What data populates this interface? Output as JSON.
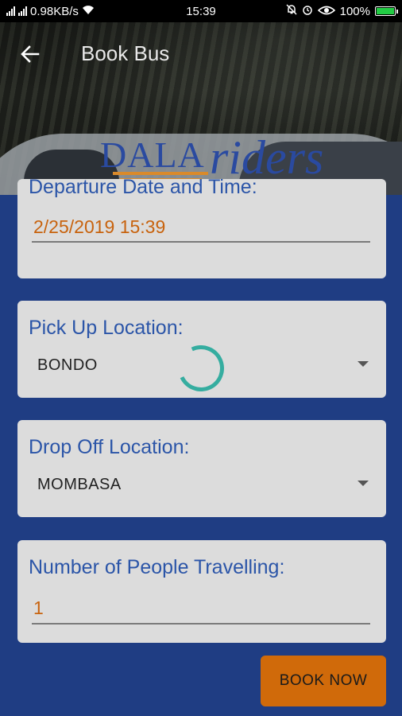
{
  "status_bar": {
    "network_speed": "0.98KB/s",
    "time": "15:39",
    "battery": "100%",
    "battery_level": 1.0
  },
  "header": {
    "title": "Book Bus",
    "logo_text_left": "DALA",
    "logo_text_right": "riders"
  },
  "form": {
    "departure": {
      "label": "Departure Date and Time:",
      "value": "2/25/2019 15:39"
    },
    "pickup": {
      "label": "Pick Up Location:",
      "value": "BONDO"
    },
    "dropoff": {
      "label": "Drop Off Location:",
      "value": "MOMBASA"
    },
    "people": {
      "label": "Number of People Travelling:",
      "value": "1"
    }
  },
  "actions": {
    "book_now": "BOOK NOW"
  },
  "colors": {
    "background": "#1f3d83",
    "label": "#2b55a8",
    "input_value": "#c8630e",
    "button": "#d06a0a",
    "spinner": "#24a89a"
  }
}
